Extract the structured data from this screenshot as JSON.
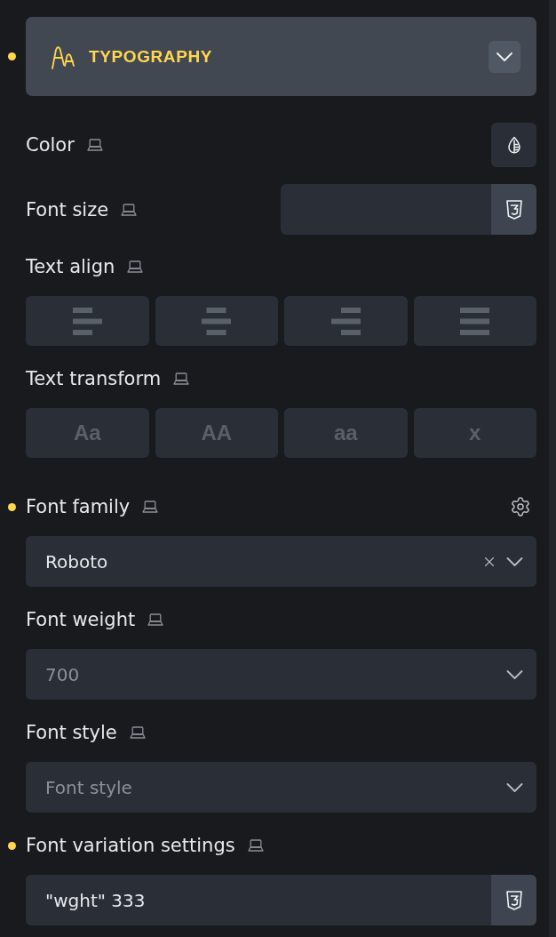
{
  "header": {
    "title": "TYPOGRAPHY",
    "modified": true,
    "expanded": true
  },
  "controls": [
    {
      "kind": "color",
      "label": "Color",
      "modified": false
    },
    {
      "kind": "inline_input",
      "label": "Font size",
      "modified": false
    },
    {
      "kind": "icon_buttons",
      "label": "Text align",
      "modified": false,
      "options": [
        {
          "kind": "left",
          "selected": false
        },
        {
          "kind": "center",
          "selected": false
        },
        {
          "kind": "right",
          "selected": false
        },
        {
          "kind": "justify",
          "selected": false
        }
      ]
    },
    {
      "kind": "text_buttons",
      "label": "Text transform",
      "modified": false,
      "options": [
        {
          "label": "Aa",
          "selected": false
        },
        {
          "label": "AA",
          "selected": false
        },
        {
          "label": "aa",
          "selected": false
        },
        {
          "label": "x",
          "selected": false
        }
      ]
    },
    {
      "kind": "select",
      "label": "Font family",
      "modified": true,
      "settings": true,
      "clearable": true,
      "value": "Roboto"
    },
    {
      "kind": "select",
      "label": "Font weight",
      "modified": false,
      "settings": false,
      "clearable": false,
      "placeholder": "700"
    },
    {
      "kind": "select",
      "label": "Font style",
      "modified": false,
      "settings": false,
      "clearable": false,
      "placeholder": "Font style"
    },
    {
      "kind": "input",
      "label": "Font variation settings",
      "modified": true,
      "value": "\"wght\" 333"
    }
  ]
}
